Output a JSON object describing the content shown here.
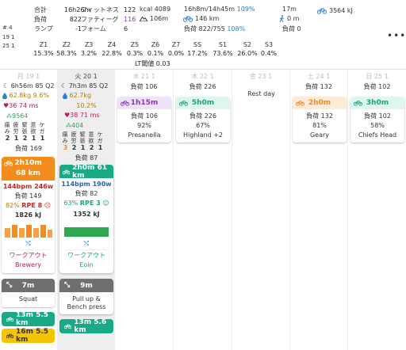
{
  "summary": {
    "weeks": [
      "# 4",
      "19 1",
      "25 1"
    ],
    "col1": [
      {
        "label": "合計",
        "value": "16h26m"
      },
      {
        "label": "負荷",
        "value": "822"
      },
      {
        "label": "ランプ",
        "value": "-1"
      }
    ],
    "col2": [
      {
        "label": "フィットネス",
        "value": "122"
      },
      {
        "label": "ファティーグ",
        "value": "116"
      },
      {
        "label": "フォーム",
        "value": "6"
      }
    ],
    "kcal": "kcal 4089",
    "elevation": "106m",
    "bike_time": "16h8m/14h45m",
    "bike_time_pct": "109%",
    "bike_dist": "146 km",
    "bike_load": "負荷 822/755",
    "bike_load_pct": "108%",
    "walk_time": "17m",
    "walk_dist": "0 m",
    "walk_load": "負荷 0",
    "energy": "3564 kJ",
    "zones": [
      {
        "name": "Z1",
        "value": "15.3%"
      },
      {
        "name": "Z2",
        "value": "58.3%"
      },
      {
        "name": "Z3",
        "value": "3.2%"
      },
      {
        "name": "Z4",
        "value": "22.8%"
      },
      {
        "name": "Z5",
        "value": "0.3%"
      },
      {
        "name": "Z6",
        "value": "0.1%"
      },
      {
        "name": "Z7",
        "value": "0.0%"
      },
      {
        "name": "SS",
        "value": "17.2%"
      },
      {
        "name": "S1",
        "value": "73.6%"
      },
      {
        "name": "S2",
        "value": "26.0%"
      },
      {
        "name": "S3",
        "value": "0.4%"
      }
    ],
    "lt": "LT閾値 0.03",
    "more": "•••"
  },
  "days": [
    {
      "header": "月 19 1",
      "sleep": "6h56m 85 Q2",
      "weight": "62.8kg",
      "weight_pct": "9.6%",
      "hrv": "36 74 ms",
      "steps": "9564",
      "wellness_labels": [
        "痛み",
        "疲労",
        "緊張",
        "意欲",
        "ケガ"
      ],
      "wellness_values": [
        "2",
        "1",
        "2",
        "1",
        "1"
      ],
      "load": "負荷 169",
      "workout": {
        "duration": "2h10m",
        "distance": "68 km",
        "hr_power": "144bpm 246w",
        "load": "負荷 149",
        "effort": "82%",
        "rpe": "RPE 8",
        "energy": "1826 kJ",
        "type": "ワークアウト",
        "name": "Brewery"
      },
      "strength": {
        "duration": "7m",
        "name": "Squat"
      },
      "rides": [
        {
          "label": "13m 5.5 km",
          "color": "teal"
        },
        {
          "label": "16m 5.5 km",
          "color": "yellow"
        }
      ]
    },
    {
      "header": "火 20 1",
      "sleep": "7h3m 85 Q2",
      "weight": "62.7kg",
      "weight_pct": "10.2%",
      "hrv": "38 71 ms",
      "steps": "404",
      "wellness_labels": [
        "痛み",
        "疲労",
        "緊張",
        "意欲",
        "ケガ"
      ],
      "wellness_values": [
        "3",
        "2",
        "1",
        "2",
        "1"
      ],
      "load": "負荷 87",
      "workout": {
        "summary": "2h0m 61 km",
        "hr_power": "114bpm 190w",
        "load": "負荷 82",
        "effort": "63%",
        "rpe": "RPE 3",
        "energy": "1352 kJ",
        "type": "ワークアウト",
        "name": "Eoin"
      },
      "strength": {
        "duration": "9m",
        "name": "Pull up & Bench press"
      },
      "rides": [
        {
          "label": "13m 5.6 km",
          "color": "teal"
        }
      ]
    },
    {
      "header": "水 21 1",
      "load": "負荷 106",
      "activity": {
        "duration": "1h15m",
        "load": "負荷 106",
        "pct": "92%",
        "name": "Presanella"
      }
    },
    {
      "header": "木 22 1",
      "load": "負荷 226",
      "activity": {
        "duration": "5h0m",
        "load": "負荷 226",
        "pct": "67%",
        "name": "Highland +2"
      }
    },
    {
      "header": "金 23 1",
      "note": "Rest day"
    },
    {
      "header": "土 24 1",
      "load": "負荷 132",
      "activity": {
        "duration": "2h0m",
        "load": "負荷 132",
        "pct": "81%",
        "name": "Geary"
      }
    },
    {
      "header": "日 25 1",
      "load": "負荷 102",
      "activity": {
        "duration": "3h0m",
        "load": "負荷 102",
        "pct": "58%",
        "name": "Chiefs Head"
      }
    }
  ],
  "colors": {
    "orange": "#f28c1c",
    "teal": "#19a985",
    "purple": "#8c35b8",
    "yellow": "#f5c400",
    "green": "#2ea84f",
    "red": "#c2185b"
  },
  "icons": [
    "moon-icon",
    "drop-icon",
    "heart-icon",
    "footprints-icon",
    "bike-icon",
    "stretch-icon",
    "walk-icon"
  ]
}
